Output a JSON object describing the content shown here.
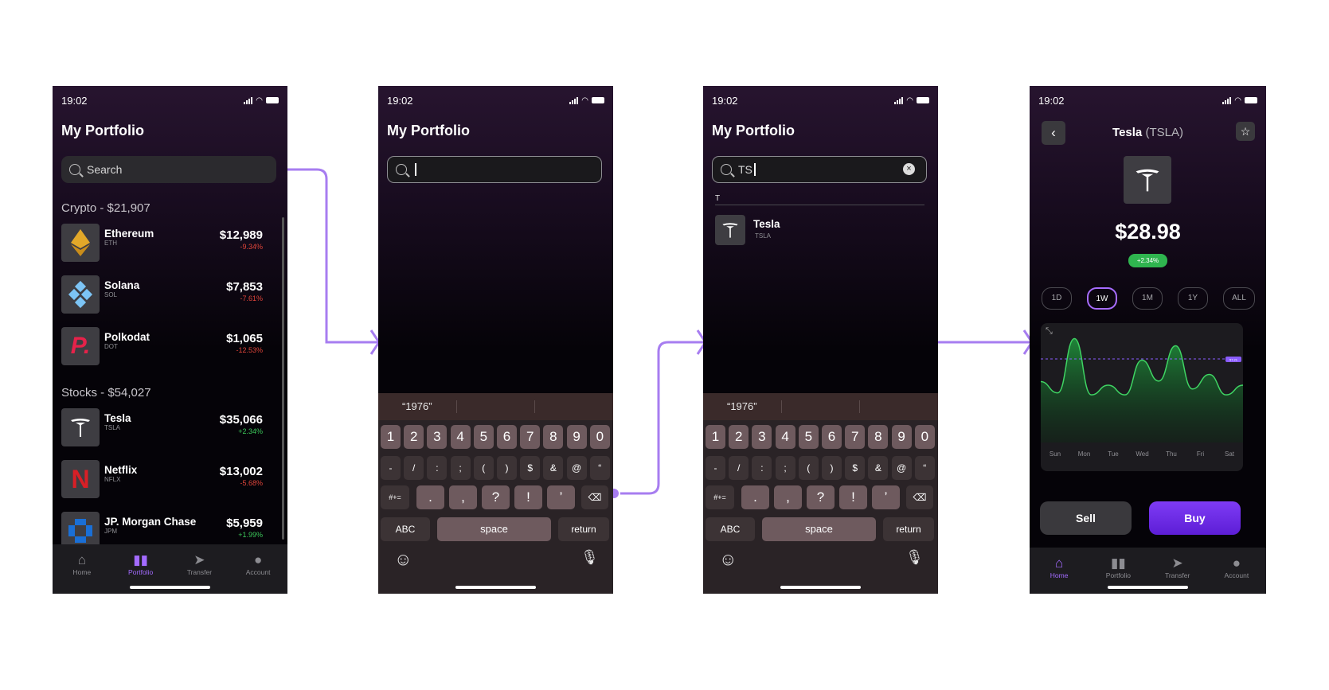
{
  "status": {
    "time": "19:02"
  },
  "screen1": {
    "title": "My Portfolio",
    "search_placeholder": "Search",
    "crypto_header": "Crypto - $21,907",
    "stocks_header": "Stocks - $54,027",
    "assets": [
      {
        "name": "Ethereum",
        "symbol": "ETH",
        "value": "$12,989",
        "change": "-9.34%",
        "direction": "down",
        "logo": "ethereum-logo"
      },
      {
        "name": "Solana",
        "symbol": "SOL",
        "value": "$7,853",
        "change": "-7.61%",
        "direction": "down",
        "logo": "solana-logo"
      },
      {
        "name": "Polkodat",
        "symbol": "DOT",
        "value": "$1,065",
        "change": "-12.53%",
        "direction": "down",
        "logo": "polkadot-logo"
      },
      {
        "name": "Tesla",
        "symbol": "TSLA",
        "value": "$35,066",
        "change": "+2.34%",
        "direction": "up",
        "logo": "tesla-logo"
      },
      {
        "name": "Netflix",
        "symbol": "NFLX",
        "value": "$13,002",
        "change": "-5.68%",
        "direction": "down",
        "logo": "netflix-logo"
      },
      {
        "name": "JP. Morgan Chase",
        "symbol": "JPM",
        "value": "$5,959",
        "change": "+1.99%",
        "direction": "up",
        "logo": "chase-logo"
      }
    ],
    "tabs": [
      {
        "label": "Home",
        "icon": "home-icon",
        "active": false
      },
      {
        "label": "Portfolio",
        "icon": "portfolio-icon",
        "active": true
      },
      {
        "label": "Transfer",
        "icon": "transfer-icon",
        "active": false
      },
      {
        "label": "Account",
        "icon": "account-icon",
        "active": false
      }
    ]
  },
  "screen2": {
    "title": "My Portfolio",
    "search_value": ""
  },
  "screen3": {
    "title": "My Portfolio",
    "search_value": "TS",
    "section_letter": "T",
    "result": {
      "name": "Tesla",
      "symbol": "TSLA"
    }
  },
  "keyboard": {
    "suggestion": "“1976”",
    "row1": [
      "1",
      "2",
      "3",
      "4",
      "5",
      "6",
      "7",
      "8",
      "9",
      "0"
    ],
    "row2": [
      "-",
      "/",
      ":",
      ";",
      "(",
      ")",
      "$",
      "&",
      "@",
      "“"
    ],
    "row3_left": "#+=",
    "row3": [
      ".",
      ",",
      "?",
      "!",
      "’"
    ],
    "abc": "ABC",
    "space": "space",
    "return": "return"
  },
  "screen4": {
    "title": "Tesla",
    "ticker": "(TSLA)",
    "price": "$28.98",
    "change": "+2.34%",
    "ranges": [
      "1D",
      "1W",
      "1M",
      "1Y",
      "ALL"
    ],
    "selected_range": "1W",
    "sell_label": "Sell",
    "buy_label": "Buy",
    "tabs": [
      {
        "label": "Home",
        "icon": "home-icon",
        "active": true
      },
      {
        "label": "Portfolio",
        "icon": "portfolio-icon",
        "active": false
      },
      {
        "label": "Transfer",
        "icon": "transfer-icon",
        "active": false
      },
      {
        "label": "Account",
        "icon": "account-icon",
        "active": false
      }
    ]
  },
  "chart_data": {
    "type": "area",
    "x": [
      "Sun",
      "Mon",
      "Tue",
      "Wed",
      "Thu",
      "Fri",
      "Sat"
    ],
    "series": [
      {
        "values": [
          0.35,
          0.95,
          0.3,
          0.65,
          0.85,
          0.45,
          0.3
        ]
      }
    ],
    "reference_line_label": "57.21",
    "colors": {
      "fill": "#1f8a3a",
      "line": "#3fd463",
      "reference": "#8a5cff"
    }
  },
  "colors": {
    "accent": "#a36bff",
    "positive": "#3cc85a",
    "negative": "#e0453a"
  }
}
